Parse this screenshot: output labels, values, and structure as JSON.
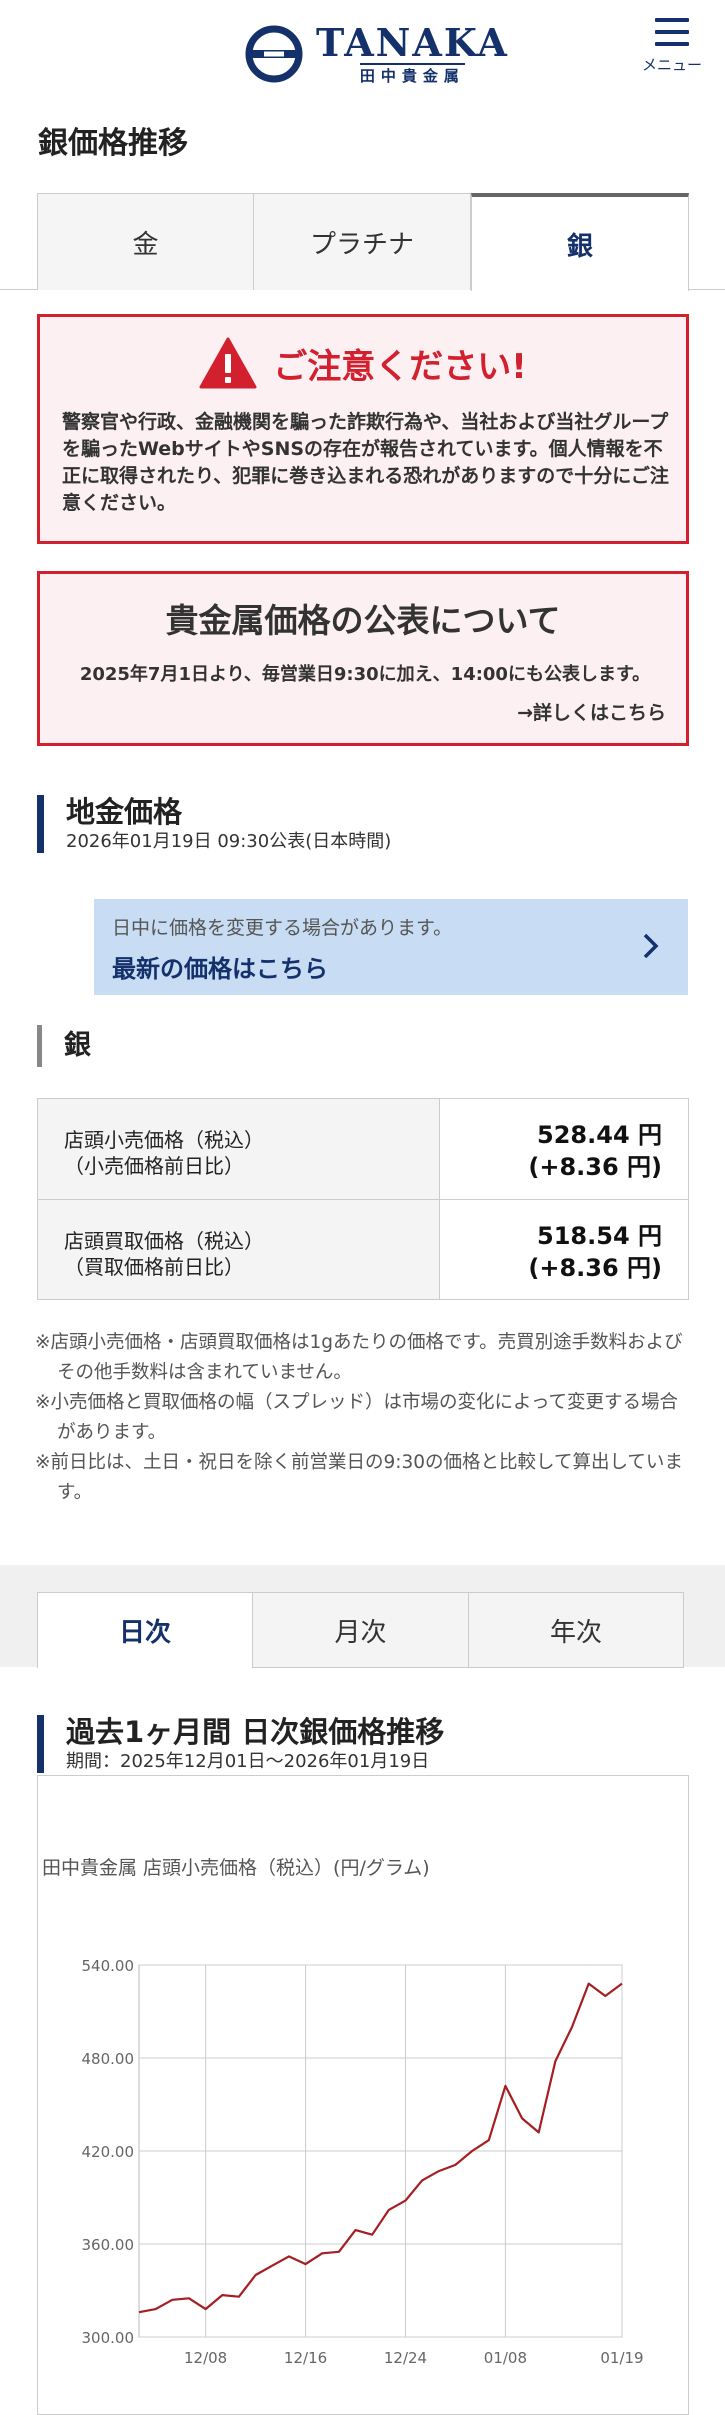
{
  "header": {
    "logo_main": "TANAKA",
    "logo_sub": "田中貴金属",
    "menu_label": "メニュー"
  },
  "page_title": "銀価格推移",
  "metal_tabs": [
    "金",
    "プラチナ",
    "銀"
  ],
  "notice_warning": {
    "title": "ご注意ください!",
    "body": "警察官や行政、金融機関を騙った詐欺行為や、当社および当社グループを騙ったWebサイトやSNSの存在が報告されています。個人情報を不正に取得されたり、犯罪に巻き込まれる恐れがありますので十分にご注意ください。"
  },
  "notice_publish": {
    "title": "貴金属価格の公表について",
    "body": "2025年7月1日より、毎営業日9:30に加え、14:00にも公表します。",
    "link": "→詳しくはこちら"
  },
  "bullion": {
    "title": "地金価格",
    "timestamp": "2026年01月19日 09:30公表(日本時間)"
  },
  "latest_banner": {
    "note": "日中に価格を変更する場合があります。",
    "link": "最新の価格はこちら"
  },
  "metal_heading": "銀",
  "prices": [
    {
      "label1": "店頭小売価格（税込）",
      "label2": "（小売価格前日比）",
      "value": "528.44 円",
      "change": "(+8.36 円)"
    },
    {
      "label1": "店頭買取価格（税込）",
      "label2": "（買取価格前日比）",
      "value": "518.54 円",
      "change": "(+8.36 円)"
    }
  ],
  "notes": [
    "※店頭小売価格・店頭買取価格は1gあたりの価格です。売買別途手数料およびその他手数料は含まれていません。",
    "※小売価格と買取価格の幅（スプレッド）は市場の変化によって変更する場合があります。",
    "※前日比は、土日・祝日を除く前営業日の9:30の価格と比較して算出しています。"
  ],
  "period_tabs": [
    "日次",
    "月次",
    "年次"
  ],
  "history": {
    "title": "過去1ヶ月間 日次銀価格推移",
    "period": "期間：2025年12月01日～2026年01月19日"
  },
  "chart_title": "田中貴金属 店頭小売価格（税込）(円/グラム)",
  "colors": {
    "brand_navy": "#14316b",
    "alert_red": "#d2202f",
    "line": "#a51e22"
  },
  "chart_data": {
    "type": "line",
    "title": "田中貴金属 店頭小売価格（税込）(円/グラム)",
    "y_ticks": [
      "300.00",
      "360.00",
      "420.00",
      "480.00",
      "540.00"
    ],
    "x_ticks": [
      "12/08",
      "12/16",
      "12/24",
      "01/08",
      "01/19"
    ],
    "ylim": [
      300,
      540
    ],
    "grid": true,
    "series": [
      {
        "values": [
          316,
          318,
          324,
          325,
          318,
          327,
          326,
          340,
          346,
          352,
          347,
          354,
          355,
          369,
          366,
          382,
          388,
          401,
          407,
          411,
          420,
          427,
          462,
          441,
          432,
          478,
          500,
          528,
          520,
          528
        ]
      }
    ]
  }
}
